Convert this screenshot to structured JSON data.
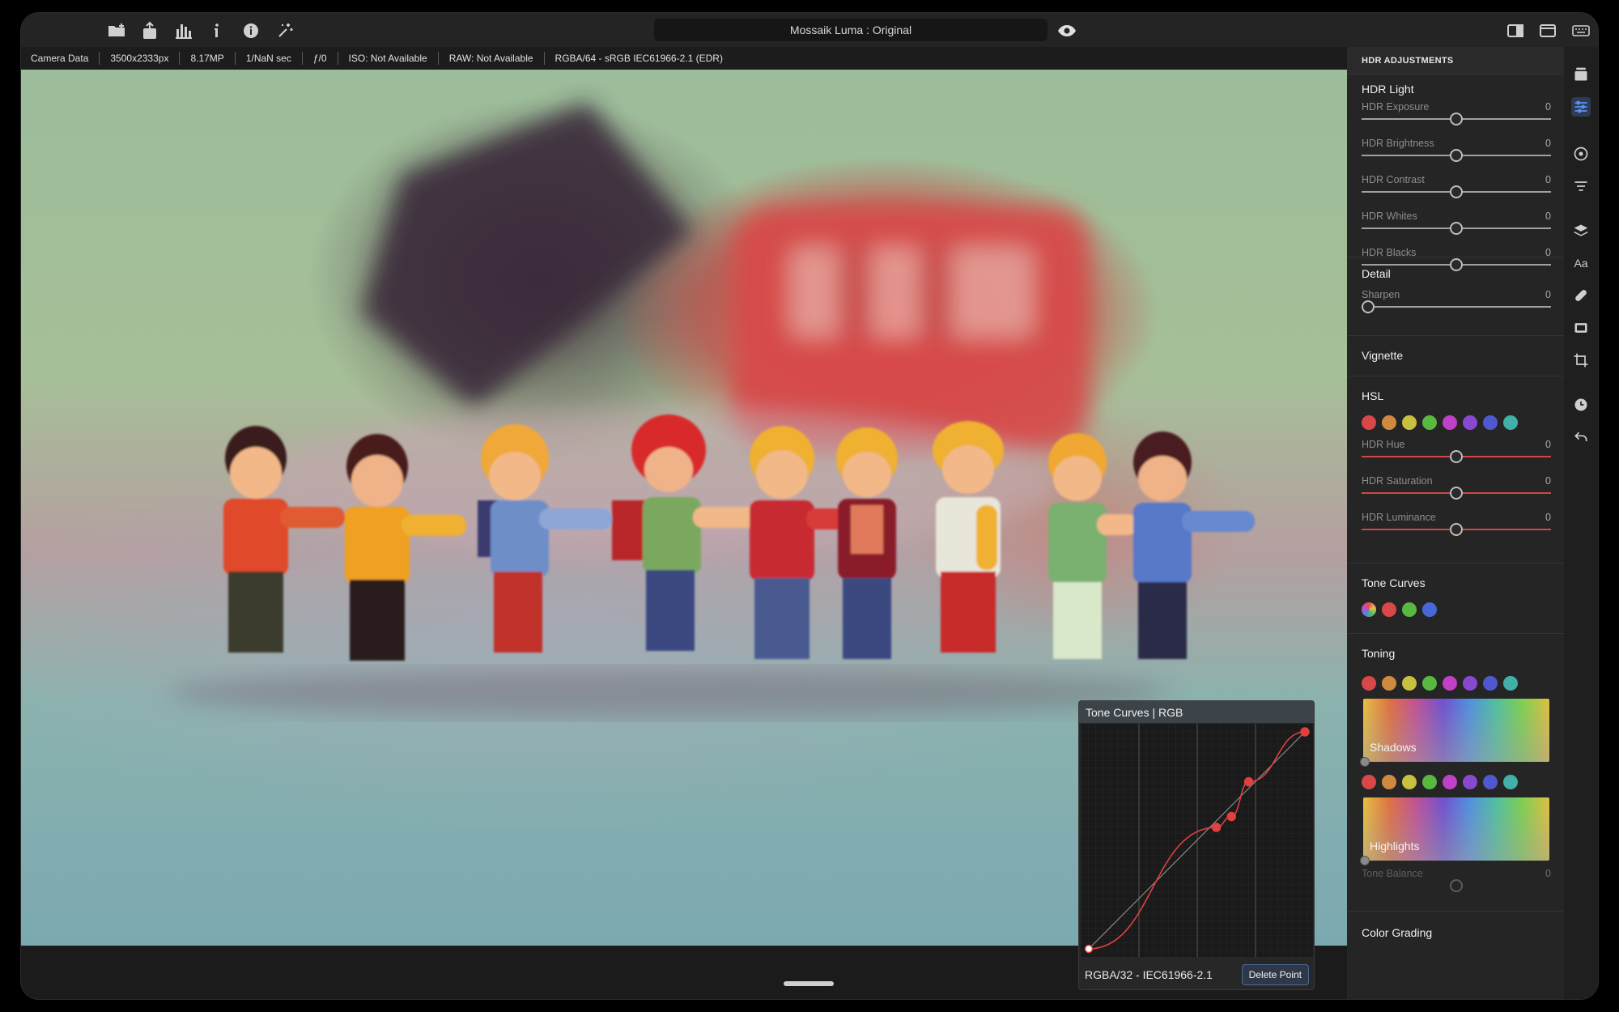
{
  "window": {
    "title": "Mossaik Luma : Original"
  },
  "toolbar": {
    "icons": [
      "import-folder-icon",
      "export-icon",
      "histogram-icon",
      "info-icon",
      "info-circle-icon",
      "magic-wand-icon"
    ],
    "right_icons": [
      "sidebar-toggle-icon",
      "window-layout-icon",
      "keyboard-icon"
    ]
  },
  "infobar": {
    "camera": "Camera Data",
    "dimensions": "3500x2333px",
    "megapixels": "8.17MP",
    "shutter": "1/NaN sec",
    "aperture": "ƒ/0",
    "iso": "ISO: Not Available",
    "raw": "RAW: Not Available",
    "colorspace": "RGBA/64 - sRGB IEC61966-2.1 (EDR)"
  },
  "tone_curve_popup": {
    "title": "Tone Curves | RGB",
    "profile": "RGBA/32 - IEC61966-2.1",
    "delete_label": "Delete Point",
    "points": [
      [
        0.0,
        0.0
      ],
      [
        0.59,
        0.56
      ],
      [
        0.66,
        0.61
      ],
      [
        0.74,
        0.77
      ],
      [
        1.0,
        1.0
      ]
    ],
    "curve_color": "#e04040"
  },
  "panel": {
    "header": "HDR ADJUSTMENTS",
    "hdr_light": {
      "title": "HDR Light",
      "sliders": [
        {
          "label": "HDR Exposure",
          "value": "0",
          "level": 0.5
        },
        {
          "label": "HDR Brightness",
          "value": "0",
          "level": 0.5
        },
        {
          "label": "HDR Contrast",
          "value": "0",
          "level": 0.5
        },
        {
          "label": "HDR Whites",
          "value": "0",
          "level": 0.5
        },
        {
          "label": "HDR Blacks",
          "value": "0",
          "level": 0.5
        }
      ]
    },
    "detail": {
      "title": "Detail",
      "sliders": [
        {
          "label": "Sharpen",
          "value": "0",
          "level": 0.0
        }
      ]
    },
    "vignette": {
      "title": "Vignette"
    },
    "hsl": {
      "title": "HSL",
      "swatches": [
        "#d84848",
        "#d08a40",
        "#c8c040",
        "#58b840",
        "#c040c8",
        "#8848d0",
        "#5058d0",
        "#40b0a8"
      ],
      "sliders": [
        {
          "label": "HDR Hue",
          "value": "0",
          "level": 0.5
        },
        {
          "label": "HDR Saturation",
          "value": "0",
          "level": 0.5
        },
        {
          "label": "HDR Luminance",
          "value": "0",
          "level": 0.5
        }
      ]
    },
    "tone_curves": {
      "title": "Tone Curves",
      "swatches": [
        "multi",
        "#d84848",
        "#58b840",
        "#4868d8"
      ]
    },
    "toning": {
      "title": "Toning",
      "swatches": [
        "#d84848",
        "#d08a40",
        "#c8c040",
        "#58b840",
        "#c040c8",
        "#8848d0",
        "#5058d0",
        "#40b0a8"
      ],
      "shadows_label": "Shadows",
      "highlights_label": "Highlights",
      "balance": {
        "label": "Tone Balance",
        "value": "0",
        "level": 0.5
      }
    },
    "color_grading": {
      "title": "Color Grading"
    }
  },
  "rail": {
    "icons": [
      "layers-stack-icon",
      "adjustments-icon",
      "target-icon",
      "filter-lines-icon",
      "layers-icon",
      "text-icon",
      "healing-icon",
      "frame-icon",
      "crop-icon",
      "history-icon",
      "undo-icon"
    ]
  }
}
